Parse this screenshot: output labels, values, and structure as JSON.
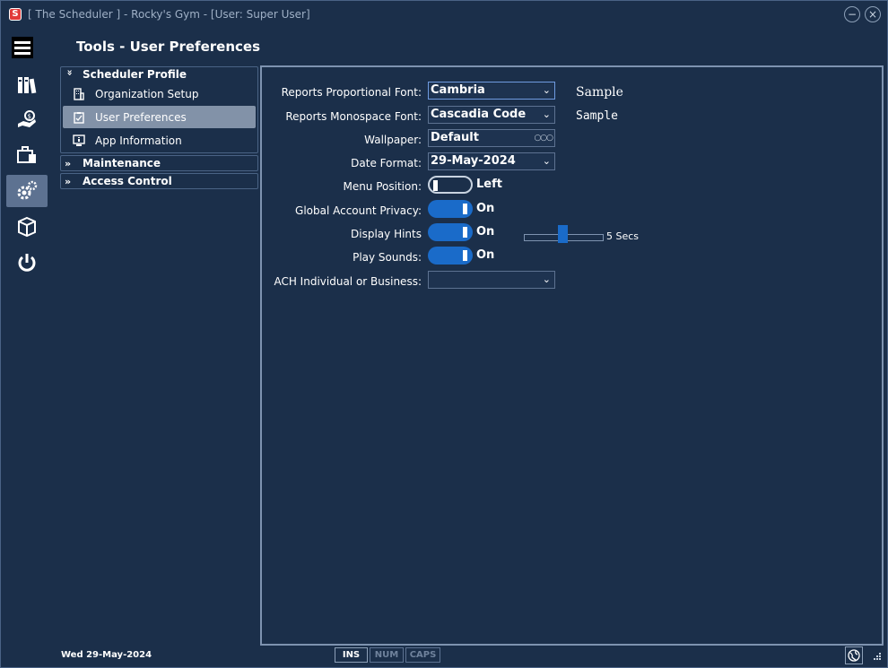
{
  "window": {
    "title": "[ The Scheduler ] - Rocky's Gym - [User: Super User]",
    "logo_letter": "S",
    "minimize_glyph": "−",
    "close_glyph": "×"
  },
  "iconbar": {
    "items": [
      {
        "name": "menu-icon"
      },
      {
        "name": "binders-icon"
      },
      {
        "name": "money-hand-icon"
      },
      {
        "name": "briefcase-icon"
      },
      {
        "name": "gears-icon",
        "active": true
      },
      {
        "name": "package-icon"
      },
      {
        "name": "power-icon"
      }
    ]
  },
  "page": {
    "title": "Tools - User Preferences"
  },
  "nav": {
    "groups": [
      {
        "label": "Scheduler Profile",
        "expanded": true,
        "items": [
          {
            "label": "Organization Setup",
            "icon": "building-icon"
          },
          {
            "label": "User Preferences",
            "icon": "clipboard-icon",
            "selected": true
          },
          {
            "label": "App Information",
            "icon": "monitor-info-icon"
          }
        ]
      },
      {
        "label": "Maintenance",
        "expanded": false
      },
      {
        "label": "Access Control",
        "expanded": false
      }
    ],
    "expanded_glyph": "»",
    "collapsed_glyph": "»"
  },
  "form": {
    "prop_font": {
      "label": "Reports Proportional Font:",
      "value": "Cambria",
      "sample": "Sample"
    },
    "mono_font": {
      "label": "Reports Monospace Font:",
      "value": "Cascadia Code",
      "sample": "Sample"
    },
    "wallpaper": {
      "label": "Wallpaper:",
      "value": "Default",
      "button": "○○○"
    },
    "date_format": {
      "label": "Date Format:",
      "value": "29-May-2024"
    },
    "menu_position": {
      "label": "Menu Position:",
      "state": "Left"
    },
    "global_privacy": {
      "label": "Global Account Privacy:",
      "state": "On"
    },
    "display_hints": {
      "label": "Display Hints",
      "state": "On",
      "slider_value_label": "5 Secs",
      "slider_fraction": 0.45
    },
    "play_sounds": {
      "label": "Play Sounds:",
      "state": "On"
    },
    "ach": {
      "label": "ACH Individual or Business:",
      "value": ""
    }
  },
  "caret_glyph": "⌄",
  "status": {
    "date": "Wed  29-May-2024",
    "keys": [
      {
        "label": "INS",
        "active": true
      },
      {
        "label": "NUM",
        "active": false
      },
      {
        "label": "CAPS",
        "active": false
      }
    ]
  },
  "colors": {
    "background": "#1b2f4a",
    "accent": "#1a6bc9",
    "selected": "#8292a8",
    "border": "#7e93b0"
  }
}
